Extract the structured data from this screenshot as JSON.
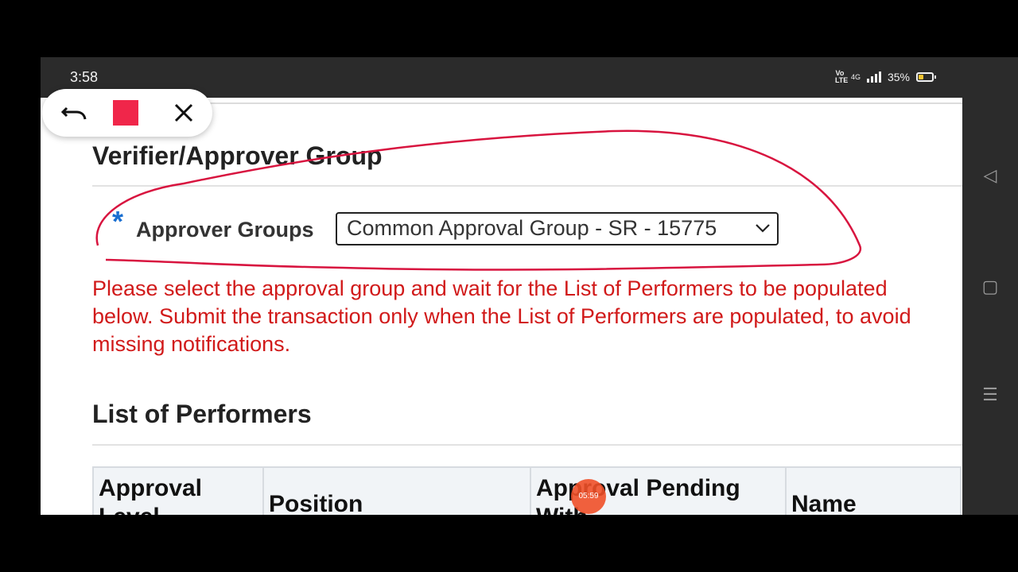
{
  "status_bar": {
    "time": "3:58",
    "network": "4G",
    "battery": "35%",
    "battery_level": 0.35
  },
  "form": {
    "section_title": "Verifier/Approver Group",
    "approver_label": "Approver Groups",
    "required_marker": "*",
    "approver_value": "Common Approval Group - SR - 15775",
    "warning": "Please select the approval group and wait for the List of Performers to be populated below. Submit the transaction only when the List of Performers are populated, to avoid missing notifications."
  },
  "performers": {
    "title": "List of Performers",
    "columns": [
      "Approval Level",
      "Position",
      "Approval Pending With",
      "Name"
    ]
  },
  "recording": {
    "timer": "05:59"
  },
  "colors": {
    "warning": "#d11a1a",
    "required": "#1a6fd1",
    "annotation": "#d8143f",
    "stop": "#f0264a"
  },
  "icons": {
    "undo": "undo-icon",
    "stop": "stop-icon",
    "close": "close-icon",
    "chevron": "chevron-down-icon"
  }
}
